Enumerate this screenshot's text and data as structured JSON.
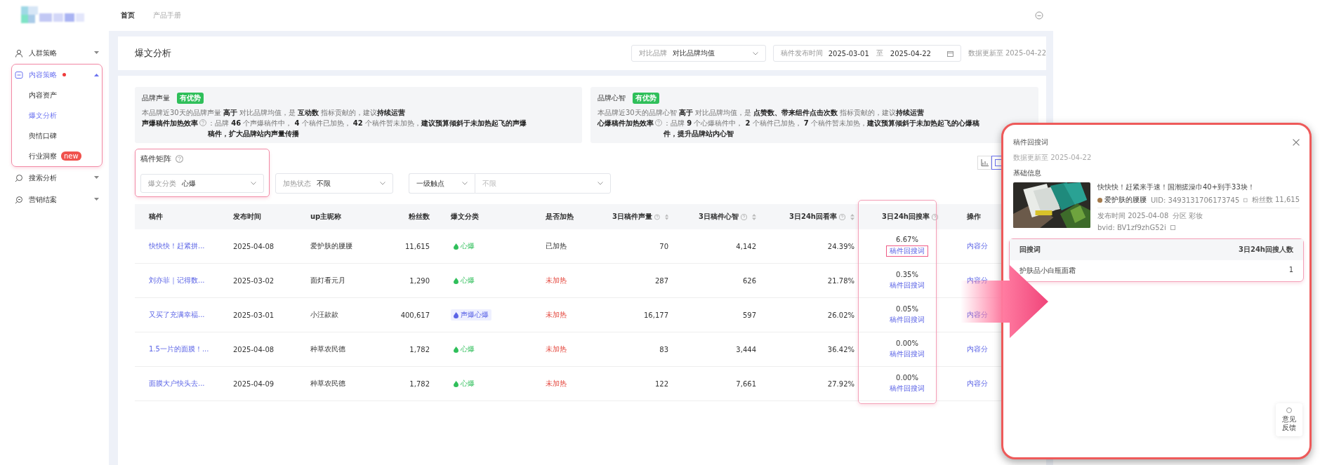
{
  "header": {
    "nav": [
      {
        "label": "首页",
        "selected": true
      },
      {
        "label": "产品手册",
        "selected": false
      }
    ]
  },
  "sidebar": {
    "items": [
      {
        "label": "人群策略",
        "expanded": false,
        "dot": false,
        "highlighted": false
      },
      {
        "label": "内容策略",
        "expanded": true,
        "dot": true,
        "highlighted": true,
        "children": [
          {
            "label": "内容资产",
            "selected": false
          },
          {
            "label": "爆文分析",
            "selected": true
          },
          {
            "label": "舆情口碑",
            "selected": false
          },
          {
            "label": "行业洞察",
            "selected": false,
            "badge": "new"
          }
        ]
      },
      {
        "label": "搜索分析",
        "expanded": false,
        "dot": false,
        "highlighted": false
      },
      {
        "label": "营销结案",
        "expanded": false,
        "dot": false,
        "highlighted": false
      }
    ]
  },
  "page_header": {
    "title": "爆文分析",
    "compare": {
      "label": "对比品牌",
      "value": "对比品牌均值"
    },
    "date_range": {
      "label": "稿件发布时间",
      "start": "2025-03-01",
      "separator": "至",
      "end": "2025-04-22"
    },
    "updated": "数据更新至 2025-04-22"
  },
  "insights": [
    {
      "title": "品牌声量",
      "badge": "有优势",
      "summary": "本品牌近30天的品牌声量 **高于** 对比品牌均值，是 **互动数** 指标贡献的，建议**持续运营**",
      "detail_label": "声爆稿件加热效率",
      "detail": "：品牌 **46** 个声爆稿件中， **4** 个稿件已加热， **42** 个稿件暂未加热，**建议预算倾斜于未加热起飞的声爆稿件，扩大品牌站内声量传播**"
    },
    {
      "title": "品牌心智",
      "badge": "有优势",
      "summary": "本品牌近30天的品牌心智 **高于** 对比品牌均值，是 **点赞数、带来组件点击次数** 指标贡献的，建议**持续运营**",
      "detail_label": "心爆稿件加热效率",
      "detail": "：品牌 **9** 个心爆稿件中， **2** 个稿件已加热， **7** 个稿件暂未加热，**建议预算倾斜于未加热起飞的心爆稿件，提升品牌站内心智**"
    }
  ],
  "matrix": {
    "title": "稿件矩阵",
    "highlighted": true,
    "filters": [
      {
        "label": "爆文分类",
        "value": "心爆"
      },
      {
        "label": "加热状态",
        "value": "不限"
      }
    ],
    "touchpoint": {
      "value": "一级触点",
      "placeholder": "不限"
    }
  },
  "table": {
    "columns": [
      {
        "label": "稿件",
        "info": false,
        "sort": false,
        "highlighted": false
      },
      {
        "label": "发布时间",
        "info": false,
        "sort": false,
        "highlighted": false
      },
      {
        "label": "up主昵称",
        "info": false,
        "sort": false,
        "highlighted": false
      },
      {
        "label": "粉丝数",
        "info": false,
        "sort": false,
        "highlighted": false
      },
      {
        "label": "爆文分类",
        "info": false,
        "sort": false,
        "highlighted": false
      },
      {
        "label": "是否加热",
        "info": false,
        "sort": false,
        "highlighted": false
      },
      {
        "label": "3日稿件声量",
        "info": true,
        "sort": true,
        "highlighted": false
      },
      {
        "label": "3日稿件心智",
        "info": true,
        "sort": true,
        "highlighted": false
      },
      {
        "label": "3日24h回看率",
        "info": true,
        "sort": true,
        "highlighted": false
      },
      {
        "label": "3日24h回搜率",
        "info": true,
        "sort": false,
        "highlighted": true
      },
      {
        "label": "操作",
        "info": false,
        "sort": false,
        "highlighted": false
      }
    ],
    "rows": [
      {
        "title": "快快快！赶紧拼...",
        "date": "2025-04-08",
        "author": "爱护肤的腰腰",
        "fans": "11,615",
        "category": "心爆",
        "kind": "mind",
        "heated": true,
        "heat_label": "已加热",
        "voice": "70",
        "mind": "4,142",
        "lookback": "24.39%",
        "research": "6.67%",
        "research_link": "稿件回搜词",
        "link_highlighted": true,
        "action": "内容分"
      },
      {
        "title": "刘亦菲｜记得数...",
        "date": "2025-03-02",
        "author": "面灯看元月",
        "fans": "1,290",
        "category": "心爆",
        "kind": "mind",
        "heated": false,
        "heat_label": "未加热",
        "voice": "287",
        "mind": "626",
        "lookback": "21.78%",
        "research": "0.35%",
        "research_link": "稿件回搜词",
        "link_highlighted": false,
        "action": "内容分"
      },
      {
        "title": "又买了充满幸福...",
        "date": "2025-03-01",
        "author": "小汪款款",
        "fans": "400,617",
        "category": "声爆心爆",
        "kind": "both",
        "heated": false,
        "heat_label": "未加热",
        "voice": "16,177",
        "mind": "597",
        "lookback": "26.02%",
        "research": "0.05%",
        "research_link": "稿件回搜词",
        "link_highlighted": false,
        "action": "内容分"
      },
      {
        "title": "1.5一片的面膜！...",
        "date": "2025-04-08",
        "author": "种草农民德",
        "fans": "1,782",
        "category": "心爆",
        "kind": "mind",
        "heated": false,
        "heat_label": "未加热",
        "voice": "83",
        "mind": "3,444",
        "lookback": "36.42%",
        "research": "0.00%",
        "research_link": "稿件回搜词",
        "link_highlighted": false,
        "action": "内容分"
      },
      {
        "title": "面膜大户快头去...",
        "date": "2025-04-09",
        "author": "种草农民德",
        "fans": "1,782",
        "category": "心爆",
        "kind": "mind",
        "heated": false,
        "heat_label": "未加热",
        "voice": "122",
        "mind": "7,661",
        "lookback": "27.92%",
        "research": "0.00%",
        "research_link": "稿件回搜词",
        "link_highlighted": false,
        "action": "内容分"
      }
    ]
  },
  "drawer": {
    "title": "稿件回搜词",
    "updated": "数据更新至 2025-04-22",
    "section": "基础信息",
    "video": {
      "kind": "picture",
      "title": "快快快！赶紧来手速！国潮搓澡巾40+到手33块！",
      "author": "爱护肤的腰腰",
      "uid": "UID: 3493131706173745",
      "fans": "粉丝数 11,615",
      "published": "发布时间 2025-04-08",
      "zone": "分区 彩妆",
      "bvid": "bvid: BV1zf9zhG52i"
    },
    "table": {
      "highlighted": true,
      "columns": [
        "回搜词",
        "3日24h回搜人数"
      ],
      "rows": [
        [
          "护肤品小白瓶面霜",
          "1"
        ]
      ]
    },
    "feedback": "意见反馈"
  }
}
